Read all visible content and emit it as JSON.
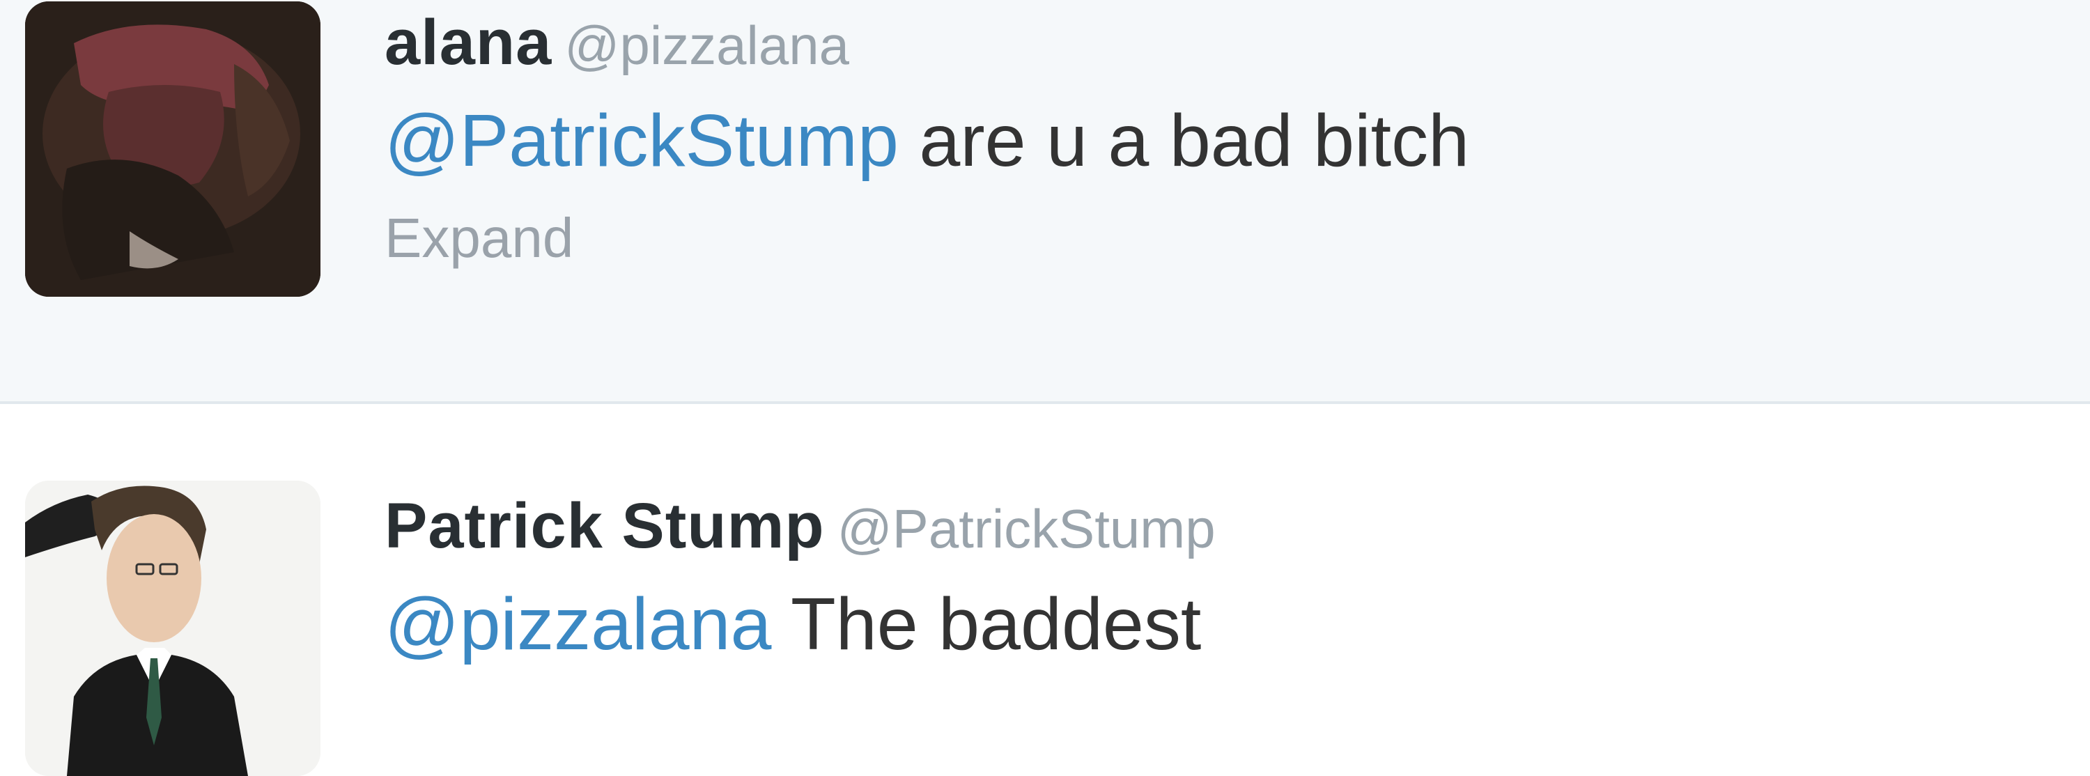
{
  "tweets": [
    {
      "name": "alana",
      "handle": "@pizzalana",
      "mention": "@PatrickStump",
      "text": " are u a bad bitch",
      "expand_label": "Expand"
    },
    {
      "name": "Patrick Stump",
      "handle": "@PatrickStump",
      "mention": "@pizzalana",
      "text": " The baddest"
    }
  ],
  "colors": {
    "mention": "#3b88c3",
    "name": "#292f33",
    "handle": "#99a3ab",
    "body_text": "#333333",
    "highlight_background": "#f5f8fa"
  }
}
